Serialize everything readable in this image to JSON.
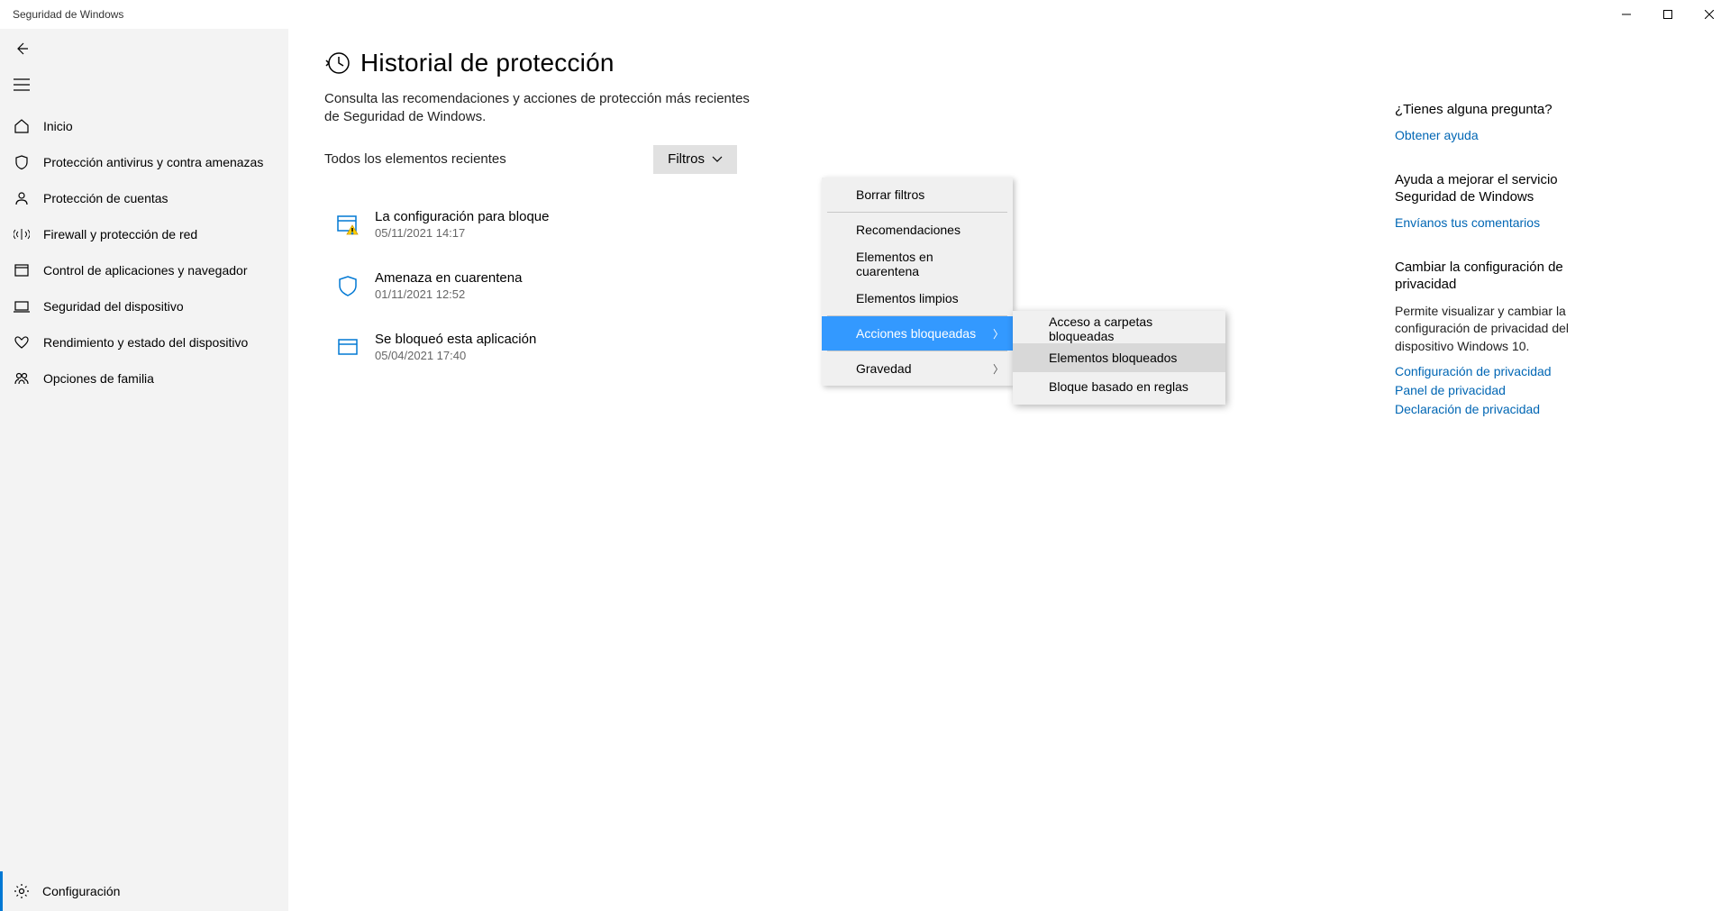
{
  "window": {
    "title": "Seguridad de Windows"
  },
  "sidebar": {
    "items": [
      {
        "label": "Inicio"
      },
      {
        "label": "Protección antivirus y contra amenazas"
      },
      {
        "label": "Protección de cuentas"
      },
      {
        "label": "Firewall y protección de red"
      },
      {
        "label": "Control de aplicaciones y navegador"
      },
      {
        "label": "Seguridad del dispositivo"
      },
      {
        "label": "Rendimiento y estado del dispositivo"
      },
      {
        "label": "Opciones de familia"
      }
    ],
    "settings_label": "Configuración"
  },
  "page": {
    "title": "Historial de protección",
    "subtitle": "Consulta las recomendaciones y acciones de protección más recientes de Seguridad de Windows.",
    "recent_label": "Todos los elementos recientes",
    "filter_button": "Filtros"
  },
  "history": [
    {
      "title": "La configuración para bloque",
      "date": "05/11/2021 14:17",
      "icon": "app-warn"
    },
    {
      "title": "Amenaza en cuarentena",
      "date": "01/11/2021 12:52",
      "icon": "shield"
    },
    {
      "title": "Se bloqueó esta aplicación",
      "date": "05/04/2021 17:40",
      "icon": "app"
    }
  ],
  "filter_menu": {
    "clear": "Borrar filtros",
    "items": [
      "Recomendaciones",
      "Elementos en cuarentena",
      "Elementos limpios",
      "Acciones bloqueadas",
      "Gravedad"
    ],
    "submenu": [
      "Acceso a carpetas bloqueadas",
      "Elementos bloqueados",
      "Bloque basado en reglas"
    ]
  },
  "right": {
    "help_heading": "¿Tienes alguna pregunta?",
    "help_link": "Obtener ayuda",
    "improve_heading": "Ayuda a mejorar el servicio Seguridad de Windows",
    "improve_link": "Envíanos tus comentarios",
    "privacy_heading": "Cambiar la configuración de privacidad",
    "privacy_text": "Permite visualizar y cambiar la configuración de privacidad del dispositivo Windows 10.",
    "privacy_link1": "Configuración de privacidad",
    "privacy_link2": "Panel de privacidad",
    "privacy_link3": "Declaración de privacidad"
  }
}
